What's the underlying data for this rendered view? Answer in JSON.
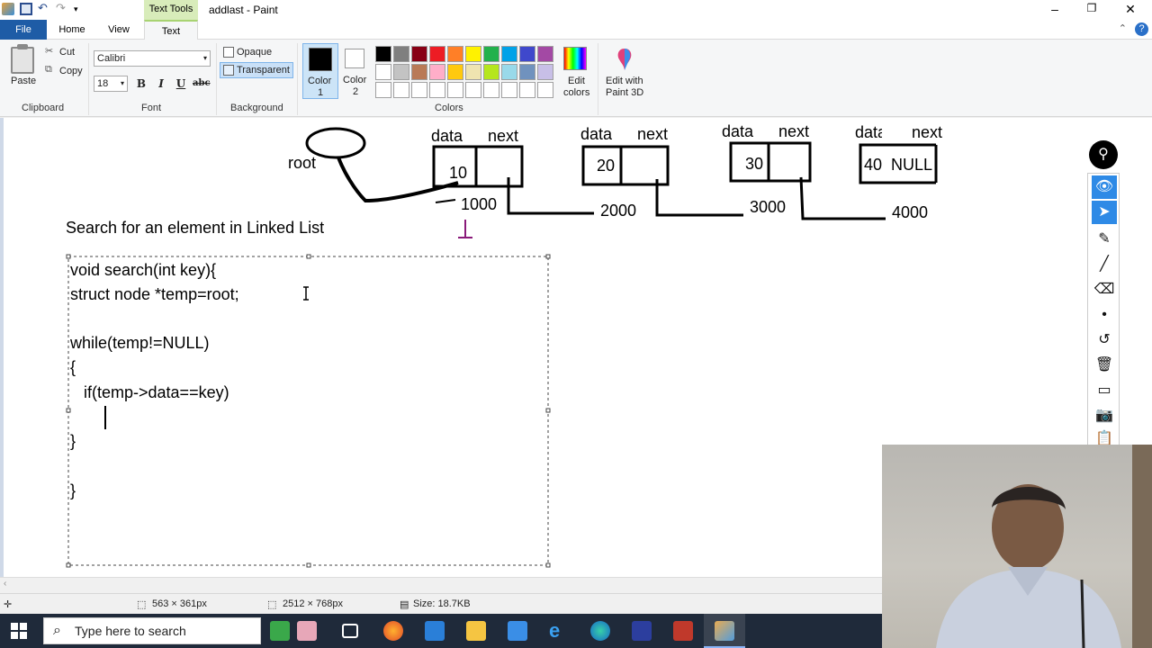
{
  "window": {
    "title": "addlast - Paint",
    "contextual_tab": "Text Tools"
  },
  "tabs": {
    "file": "File",
    "home": "Home",
    "view": "View",
    "text": "Text"
  },
  "ribbon": {
    "clipboard": {
      "paste": "Paste",
      "cut": "Cut",
      "copy": "Copy",
      "label": "Clipboard"
    },
    "font": {
      "family": "Calibri",
      "size": "18",
      "bold": "B",
      "italic": "I",
      "underline": "U",
      "strike": "abc",
      "label": "Font"
    },
    "background": {
      "opaque": "Opaque",
      "transparent": "Transparent",
      "label": "Background"
    },
    "colors": {
      "color1": "Color\n1",
      "color1_line1": "Color",
      "color1_line2": "1",
      "color2_line1": "Color",
      "color2_line2": "2",
      "color1_value": "#000000",
      "color2_value": "#ffffff",
      "edit_colors_line1": "Edit",
      "edit_colors_line2": "colors",
      "label": "Colors",
      "palette": [
        "#000000",
        "#7f7f7f",
        "#880015",
        "#ed1c24",
        "#ff7f27",
        "#fff200",
        "#22b14c",
        "#00a2e8",
        "#3f48cc",
        "#a349a4",
        "#ffffff",
        "#c3c3c3",
        "#b97a57",
        "#ffaec9",
        "#ffc90e",
        "#efe4b0",
        "#b5e61d",
        "#99d9ea",
        "#7092be",
        "#c8bfe7",
        "#ffffff",
        "#ffffff",
        "#ffffff",
        "#ffffff",
        "#ffffff",
        "#ffffff",
        "#ffffff",
        "#ffffff",
        "#ffffff",
        "#ffffff"
      ]
    },
    "paint3d": {
      "line1": "Edit with",
      "line2": "Paint 3D"
    }
  },
  "canvas": {
    "diagram": {
      "root_label": "root",
      "data_label": "data",
      "next_label": "next",
      "nodes": [
        {
          "data": "10",
          "next": "",
          "address": "1000"
        },
        {
          "data": "20",
          "next": "",
          "address": "2000"
        },
        {
          "data": "30",
          "next": "",
          "address": "3000"
        },
        {
          "data": "40",
          "next": "NULL",
          "address": "4000"
        }
      ]
    },
    "heading": "Search for an element in Linked List",
    "code": [
      "void search(int key){",
      "struct node *temp=root;",
      "",
      "while(temp!=NULL)",
      "{",
      "   if(temp->data==key)",
      "",
      "}",
      "",
      "}"
    ]
  },
  "status": {
    "cursor_pos": "563 × 361px",
    "image_size": "2512 × 768px",
    "file_size": "Size: 18.7KB"
  },
  "taskbar": {
    "search_placeholder": "Type here to search"
  }
}
